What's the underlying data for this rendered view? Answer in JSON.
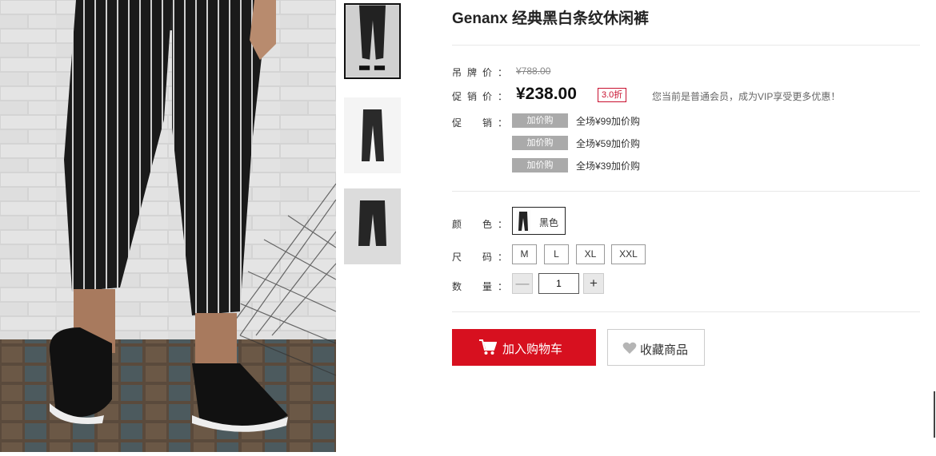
{
  "product": {
    "title": "Genanx 经典黑白条纹休闲裤"
  },
  "labels": {
    "tag_price": "吊牌价：",
    "sale_price": "促销价：",
    "promotion": "促　销：",
    "color": "颜　色：",
    "size": "尺　码：",
    "quantity": "数　量："
  },
  "price": {
    "tag": "¥788.00",
    "sale": "¥238.00",
    "discount": "3.0折",
    "member_note": "您当前是普通会员，成为VIP享受更多优惠！"
  },
  "promotions": [
    {
      "badge": "加价购",
      "text": "全场¥99加价购"
    },
    {
      "badge": "加价购",
      "text": "全场¥59加价购"
    },
    {
      "badge": "加价购",
      "text": "全场¥39加价购"
    }
  ],
  "colors": [
    {
      "name": "黑色",
      "selected": true
    }
  ],
  "sizes": [
    "M",
    "L",
    "XL",
    "XXL"
  ],
  "quantity": {
    "minus": "—",
    "value": "1",
    "plus": "+"
  },
  "actions": {
    "add_to_cart": "加入购物车",
    "favorite": "收藏商品"
  },
  "icons": {
    "cart": "cart-icon",
    "heart": "heart-icon"
  },
  "theme": {
    "accent": "#d7101f",
    "badge_bg": "#aaaaaa",
    "discount": "#c8102e"
  }
}
